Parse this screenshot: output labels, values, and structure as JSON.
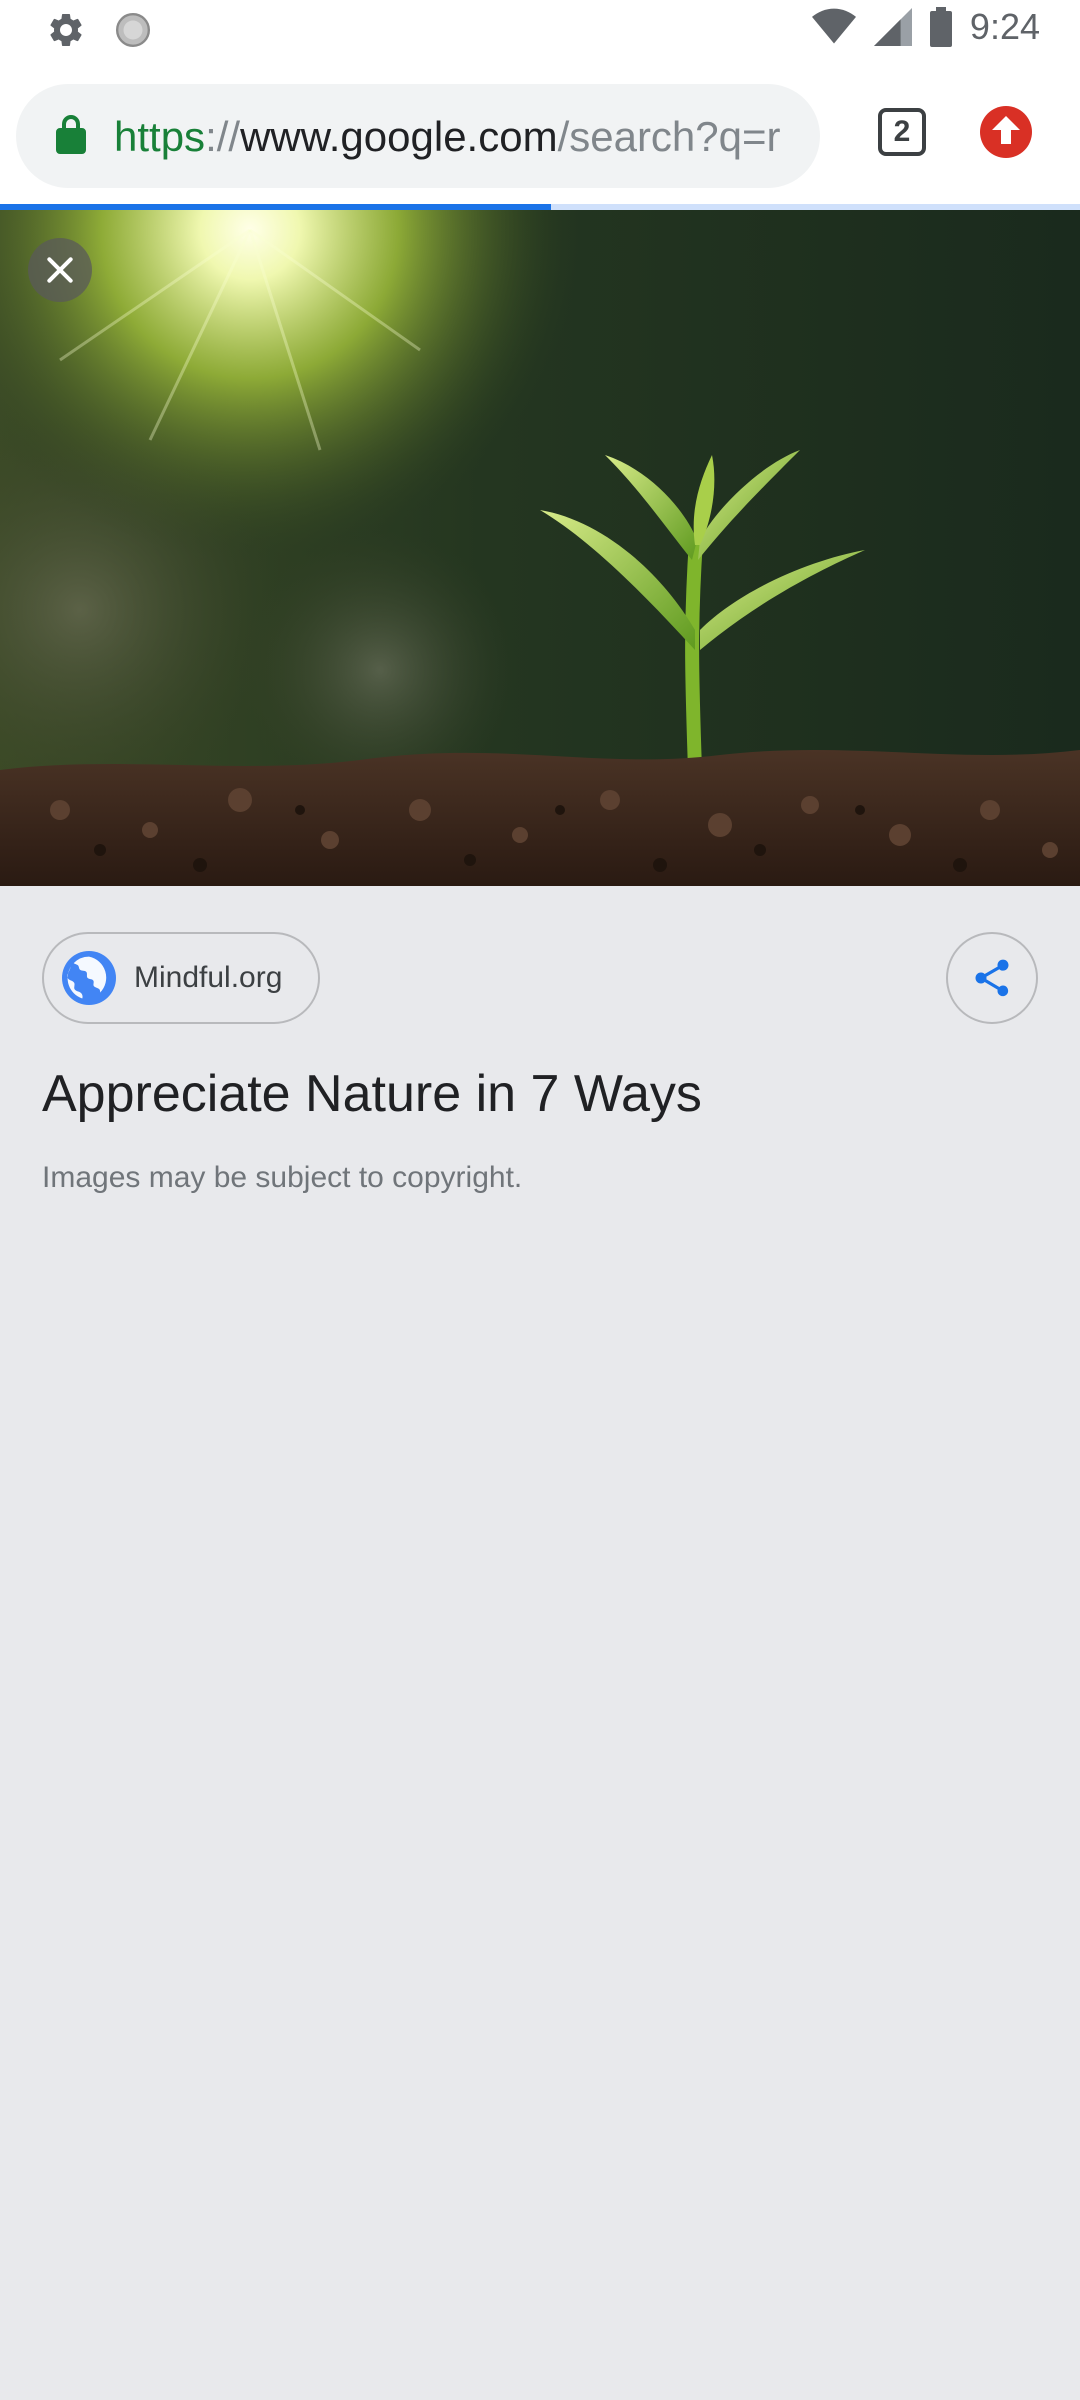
{
  "status_bar": {
    "time": "9:24",
    "icons": [
      "settings-gear-icon",
      "loading-circle-icon",
      "wifi-icon",
      "cell-signal-icon",
      "battery-icon"
    ]
  },
  "browser": {
    "url": {
      "scheme": "https",
      "separator": "://",
      "host": "www.google.com",
      "path": "/search?q=r"
    },
    "tab_count": "2",
    "load_progress": 0.51,
    "colors": {
      "accent": "#1a73e8",
      "secure_green": "#188038",
      "update_red": "#d93025"
    }
  },
  "image_viewer": {
    "image_description_icon": "seedling-in-soil-photo",
    "source": {
      "name": "Mindful.org",
      "icon": "globe-icon"
    },
    "title": "Appreciate Nature in 7 Ways",
    "copyright_notice": "Images may be subject to copyright."
  }
}
